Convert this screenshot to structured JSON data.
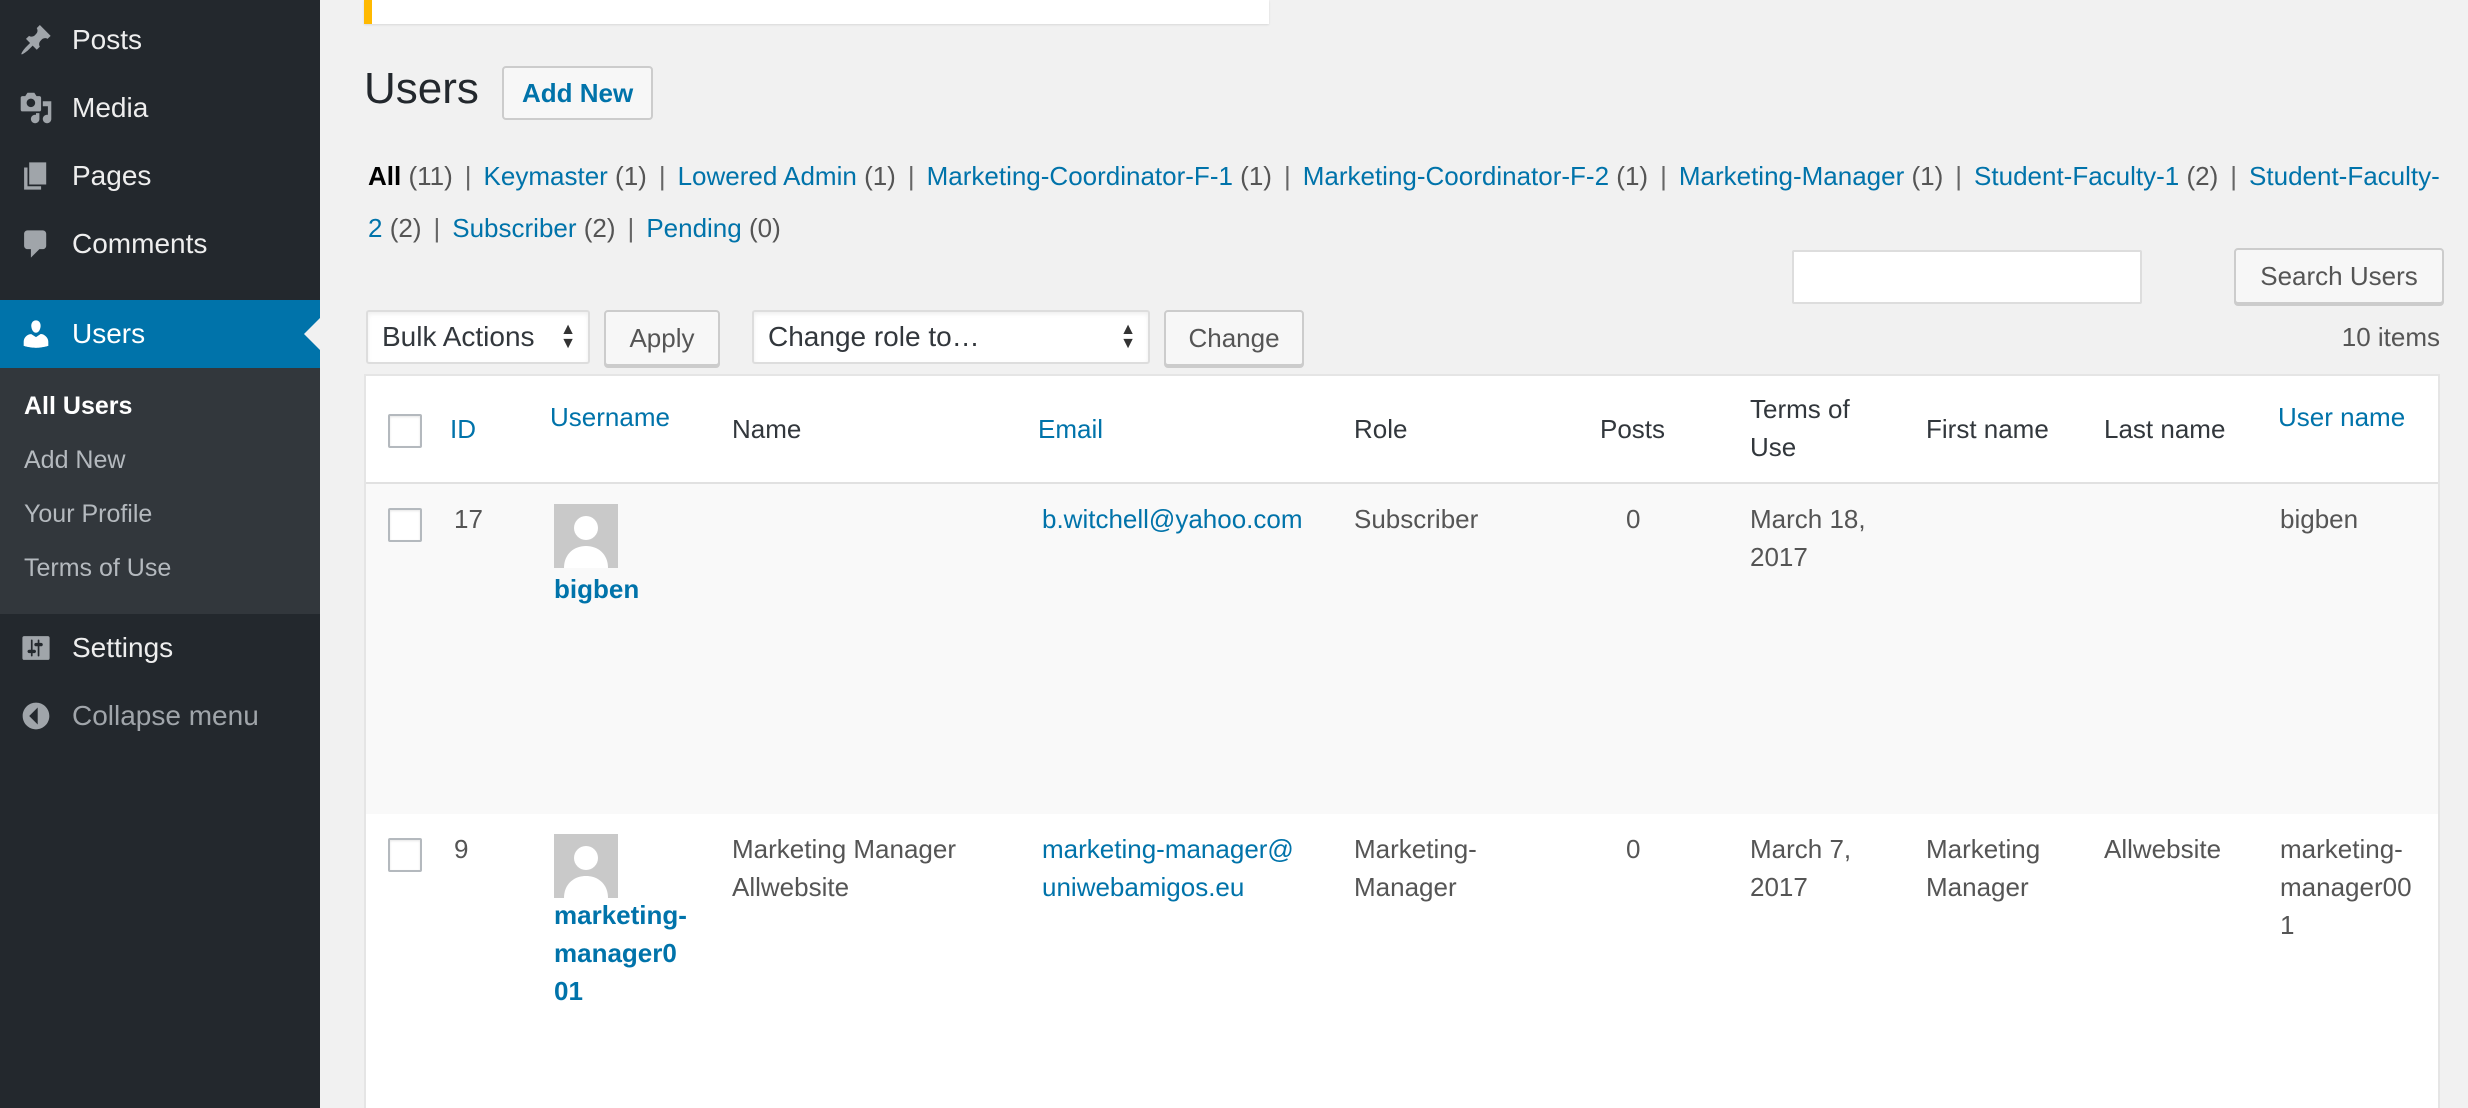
{
  "sidebar": {
    "menu": {
      "posts": "Posts",
      "media": "Media",
      "pages": "Pages",
      "comments": "Comments",
      "users": "Users",
      "settings": "Settings",
      "collapse": "Collapse menu"
    },
    "submenu": {
      "all_users": "All Users",
      "add_new": "Add New",
      "your_profile": "Your Profile",
      "terms_of_use": "Terms of Use"
    }
  },
  "header": {
    "title": "Users",
    "add_new": "Add New"
  },
  "filters": [
    {
      "label": "All",
      "count": "(11)"
    },
    {
      "label": "Keymaster",
      "count": "(1)"
    },
    {
      "label": "Lowered Admin",
      "count": "(1)"
    },
    {
      "label": "Marketing-Coordinator-F-1",
      "count": "(1)"
    },
    {
      "label": "Marketing-Coordinator-F-2",
      "count": "(1)"
    },
    {
      "label": "Marketing-Manager",
      "count": "(1)"
    },
    {
      "label": "Student-Faculty-1",
      "count": "(2)"
    },
    {
      "label": "Student-Faculty-2",
      "count": "(2)"
    },
    {
      "label": "Subscriber",
      "count": "(2)"
    },
    {
      "label": "Pending",
      "count": "(0)"
    }
  ],
  "search": {
    "button": "Search Users",
    "value": ""
  },
  "toolbar": {
    "bulk_actions": "Bulk Actions",
    "apply": "Apply",
    "change_role": "Change role to…",
    "change": "Change",
    "items_count": "10 items"
  },
  "table": {
    "headers": {
      "id": "ID",
      "username": "Username",
      "name": "Name",
      "email": "Email",
      "role": "Role",
      "posts": "Posts",
      "terms_of_use": "Terms of Use",
      "first_name": "First name",
      "last_name": "Last name",
      "user_name": "User name"
    },
    "rows": [
      {
        "id": "17",
        "username": "bigben",
        "name": "",
        "email": "b.witchell@yahoo.com",
        "role": "Subscriber",
        "posts": "0",
        "terms_of_use": "March 18, 2017",
        "first_name": "",
        "last_name": "",
        "user_name": "bigben"
      },
      {
        "id": "9",
        "username": "marketing-manager001",
        "name": "Marketing Manager Allwebsite",
        "email": "marketing-manager@uniwebamigos.eu",
        "role": "Marketing-Manager",
        "posts": "0",
        "terms_of_use": "March 7, 2017",
        "first_name": "Marketing Manager",
        "last_name": "Allwebsite",
        "user_name": "marketing-manager001"
      }
    ]
  },
  "colors": {
    "sidebar_bg": "#23282d",
    "submenu_bg": "#32373c",
    "accent": "#0073aa",
    "notice": "#ffb900"
  }
}
